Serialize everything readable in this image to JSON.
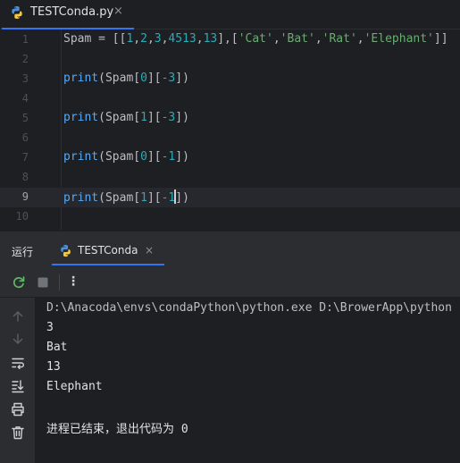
{
  "editor_tab": {
    "filename": "TESTConda.py",
    "close": "×"
  },
  "editor": {
    "lines": [
      {
        "num": "1",
        "tokens": [
          [
            "t",
            "Spam = [["
          ],
          [
            "n",
            "1"
          ],
          [
            "t",
            ","
          ],
          [
            "n",
            "2"
          ],
          [
            "t",
            ","
          ],
          [
            "n",
            "3"
          ],
          [
            "t",
            ","
          ],
          [
            "n",
            "4513"
          ],
          [
            "t",
            ","
          ],
          [
            "n",
            "13"
          ],
          [
            "t",
            "],["
          ],
          [
            "s",
            "'Cat'"
          ],
          [
            "t",
            ","
          ],
          [
            "s",
            "'Bat'"
          ],
          [
            "t",
            ","
          ],
          [
            "s",
            "'Rat'"
          ],
          [
            "t",
            ","
          ],
          [
            "s",
            "'Elephant'"
          ],
          [
            "t",
            "]]"
          ]
        ]
      },
      {
        "num": "2",
        "tokens": []
      },
      {
        "num": "3",
        "tokens": [
          [
            "k",
            "print"
          ],
          [
            "t",
            "(Spam["
          ],
          [
            "n",
            "0"
          ],
          [
            "t",
            "]["
          ],
          [
            "n",
            "-3"
          ],
          [
            "t",
            "])"
          ]
        ]
      },
      {
        "num": "4",
        "tokens": []
      },
      {
        "num": "5",
        "tokens": [
          [
            "k",
            "print"
          ],
          [
            "t",
            "(Spam["
          ],
          [
            "n",
            "1"
          ],
          [
            "t",
            "]["
          ],
          [
            "n",
            "-3"
          ],
          [
            "t",
            "])"
          ]
        ]
      },
      {
        "num": "6",
        "tokens": []
      },
      {
        "num": "7",
        "tokens": [
          [
            "k",
            "print"
          ],
          [
            "t",
            "(Spam["
          ],
          [
            "n",
            "0"
          ],
          [
            "t",
            "]["
          ],
          [
            "n",
            "-1"
          ],
          [
            "t",
            "])"
          ]
        ]
      },
      {
        "num": "8",
        "tokens": []
      },
      {
        "num": "9",
        "tokens": [
          [
            "k",
            "print"
          ],
          [
            "t",
            "(Spam["
          ],
          [
            "n",
            "1"
          ],
          [
            "t",
            "]["
          ],
          [
            "n",
            "-1"
          ],
          [
            "c",
            ""
          ],
          [
            "t",
            "])"
          ]
        ],
        "current": true
      },
      {
        "num": "10",
        "tokens": []
      }
    ]
  },
  "run_panel": {
    "title": "运行",
    "tab_label": "TESTConda",
    "tab_close": "×",
    "more_menu": "⋮"
  },
  "console": {
    "lines": [
      "D:\\Anacoda\\envs\\condaPython\\python.exe D:\\BrowerApp\\python",
      "3",
      "Bat",
      "13",
      "Elephant",
      "",
      "进程已结束，退出代码为 0"
    ]
  },
  "colors": {
    "accent": "#3574f0",
    "keyword": "#56a8f5",
    "number": "#2aacb8",
    "string": "#6aab73",
    "rerun": "#5fb865"
  },
  "icons": {
    "rerun": "rerun-icon",
    "stop": "stop-icon",
    "up": "arrow-up-icon",
    "down": "arrow-down-icon",
    "soft_wrap": "soft-wrap-icon",
    "scroll_end": "scroll-to-end-icon",
    "print": "print-icon",
    "trash": "trash-icon"
  }
}
